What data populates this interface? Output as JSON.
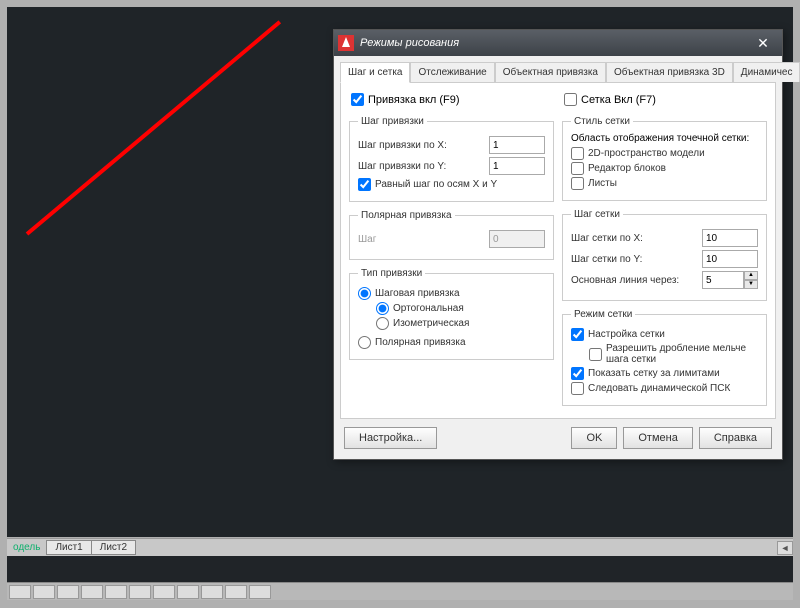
{
  "sheets": {
    "model": "одель",
    "sheet1": "Лист1",
    "sheet2": "Лист2"
  },
  "dialog": {
    "title": "Режимы рисования",
    "tabs": {
      "snap_grid": "Шаг и сетка",
      "tracking": "Отслеживание",
      "osnap": "Объектная привязка",
      "osnap3d": "Объектная привязка 3D",
      "dynamic": "Динамичес"
    },
    "snap_on": "Привязка вкл (F9)",
    "grid_on": "Сетка Вкл (F7)",
    "snap_step": {
      "legend": "Шаг привязки",
      "x": "Шаг привязки по X:",
      "y": "Шаг привязки по Y:",
      "equal": "Равный шаг по осям X и Y",
      "vx": "1",
      "vy": "1"
    },
    "polar": {
      "legend": "Полярная привязка",
      "step": "Шаг",
      "v": "0"
    },
    "snap_type": {
      "legend": "Тип привязки",
      "step": "Шаговая привязка",
      "ortho": "Ортогональная",
      "iso": "Изометрическая",
      "polar": "Полярная привязка"
    },
    "grid_style": {
      "legend": "Стиль сетки",
      "area": "Область отображения точечной сетки:",
      "model2d": "2D-пространство модели",
      "blockedit": "Редактор блоков",
      "sheets": "Листы"
    },
    "grid_step": {
      "legend": "Шаг сетки",
      "x": "Шаг сетки по X:",
      "y": "Шаг сетки по Y:",
      "major": "Основная линия через:",
      "vx": "10",
      "vy": "10",
      "vm": "5"
    },
    "grid_mode": {
      "legend": "Режим сетки",
      "adaptive": "Настройка сетки",
      "subdiv": "Разрешить дробление мельче шага сетки",
      "limits": "Показать сетку за лимитами",
      "dynucs": "Следовать динамической ПСК"
    },
    "buttons": {
      "options": "Настройка...",
      "ok": "OK",
      "cancel": "Отмена",
      "help": "Справка"
    }
  }
}
